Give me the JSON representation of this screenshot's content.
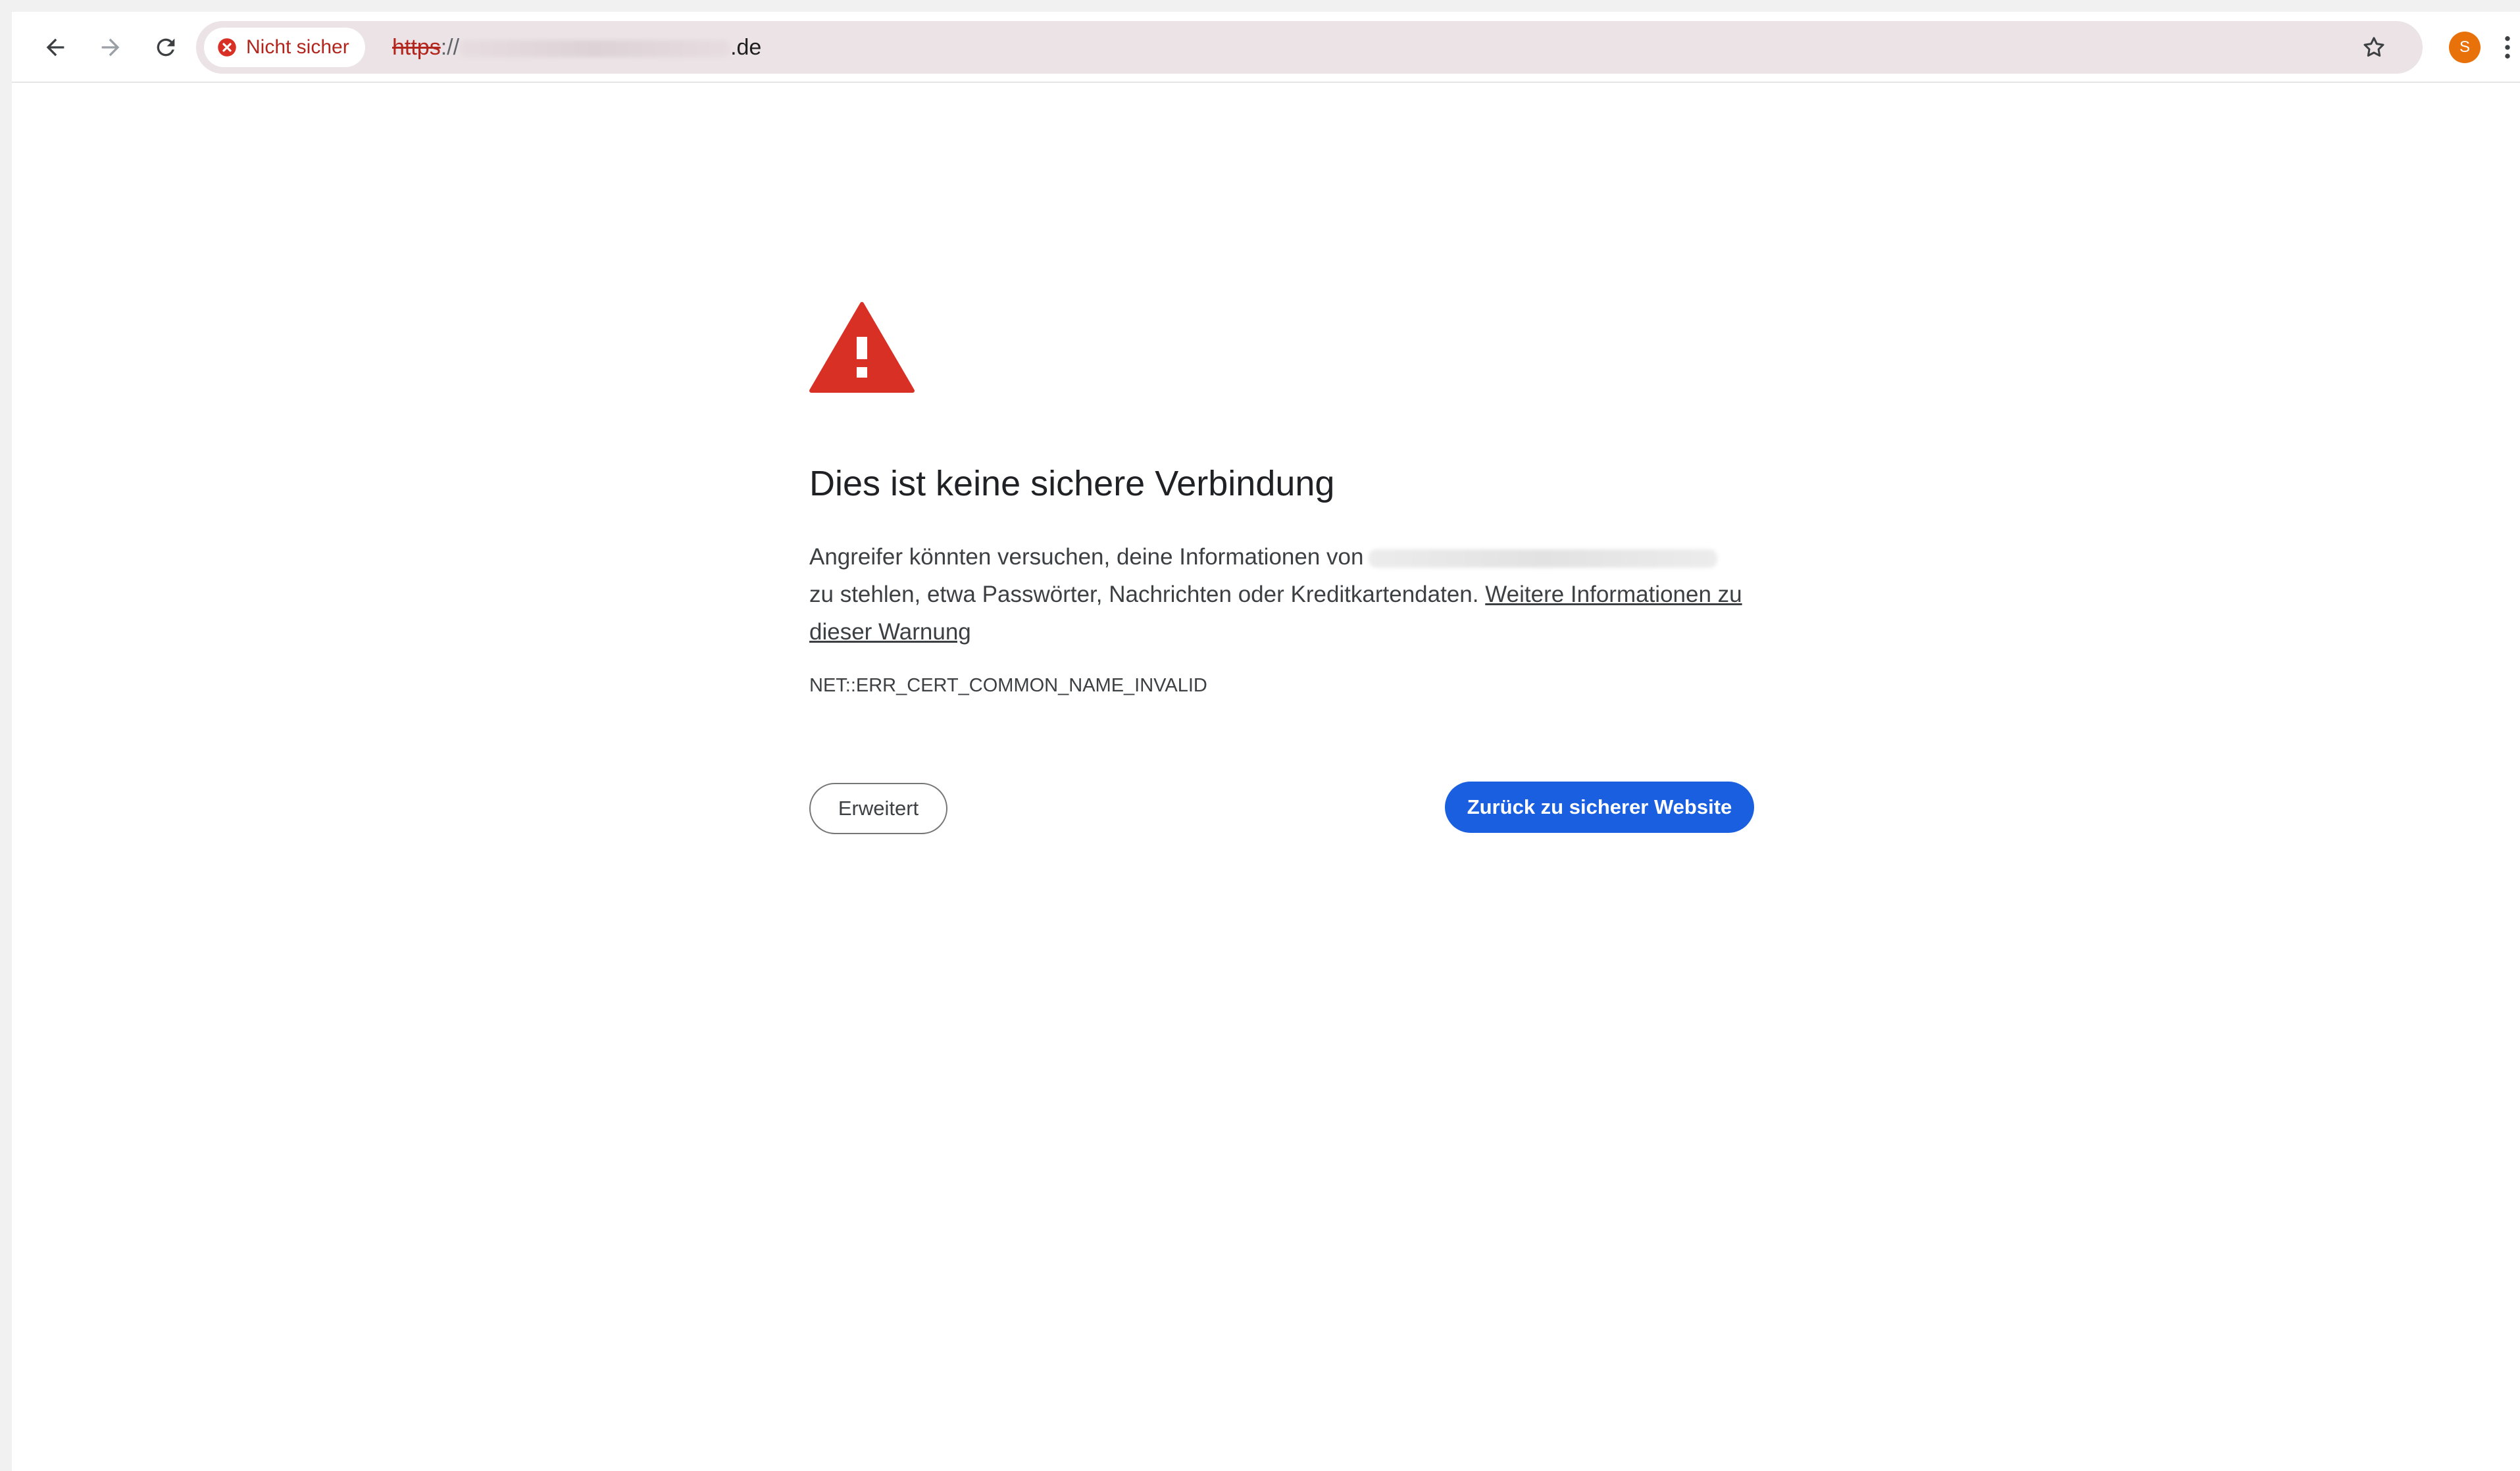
{
  "browser": {
    "security_chip_label": "Nicht sicher",
    "url": {
      "scheme": "https",
      "separator": "://",
      "tld": ".de"
    },
    "profile_initial": "S"
  },
  "interstitial": {
    "headline": "Dies ist keine sichere Verbindung",
    "body_part1": "Angreifer könnten versuchen, deine Informationen von",
    "body_part2": "zu stehlen, etwa Passwörter, Nachrichten oder Kreditkartendaten.",
    "learn_more_link": "Weitere Informationen zu dieser Warnung",
    "error_code": "NET::ERR_CERT_COMMON_NAME_INVALID",
    "advanced_button": "Erweitert",
    "back_button": "Zurück zu sicherer Website"
  },
  "colors": {
    "danger": "#d93025",
    "primary_button": "#1a5fe0",
    "chip_text": "#b3261e"
  }
}
